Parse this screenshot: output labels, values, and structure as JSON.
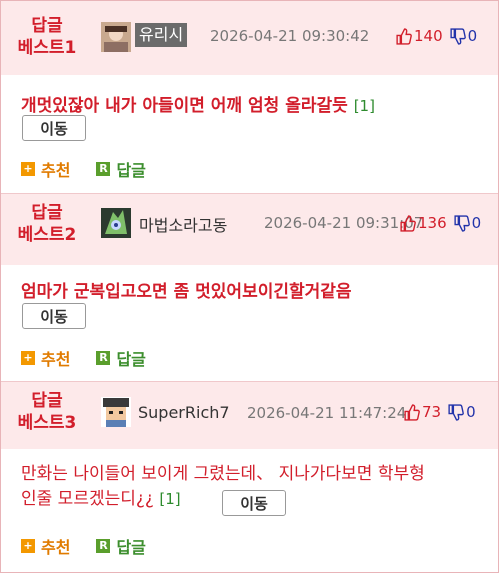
{
  "posts": [
    {
      "best_line1": "답글",
      "best_line2": "베스트1",
      "nickname": "유리시",
      "date": "2026-04-21 09:30:42",
      "likes": "140",
      "dislikes": "0",
      "content": "개멋있잖아 내가 아들이면 어깨 엄청 올라갈듯",
      "reply_count": "[1]",
      "move_label": "이동",
      "recommend_label": "추천",
      "reply_label": "답글"
    },
    {
      "best_line1": "답글",
      "best_line2": "베스트2",
      "nickname": "마법소라고동",
      "date": "2026-04-21 09:31:07",
      "likes": "136",
      "dislikes": "0",
      "content": "엄마가 군복입고오면 좀 멋있어보이긴할거같음",
      "move_label": "이동",
      "recommend_label": "추천",
      "reply_label": "답글"
    },
    {
      "best_line1": "답글",
      "best_line2": "베스트3",
      "nickname": "SuperRich7",
      "date": "2026-04-21 11:47:24",
      "likes": "73",
      "dislikes": "0",
      "content_line1": "만화는 나이들어 보이게 그렸는데、 지나가다보면 학부형",
      "content_line2": "인줄 모르겠는디¿¿",
      "reply_count": "[1]",
      "move_label": "이동",
      "recommend_label": "추천",
      "reply_label": "답글"
    }
  ],
  "colors": {
    "accent_red": "#d21e2b",
    "header_bg": "#fde9ea",
    "recommend_orange": "#f39800",
    "reply_green": "#5a9e2c",
    "dislike_blue": "#2233aa"
  },
  "icons": [
    "avatar-image",
    "thumbs-up-icon",
    "thumbs-down-icon",
    "plus-square-icon",
    "r-square-icon"
  ]
}
